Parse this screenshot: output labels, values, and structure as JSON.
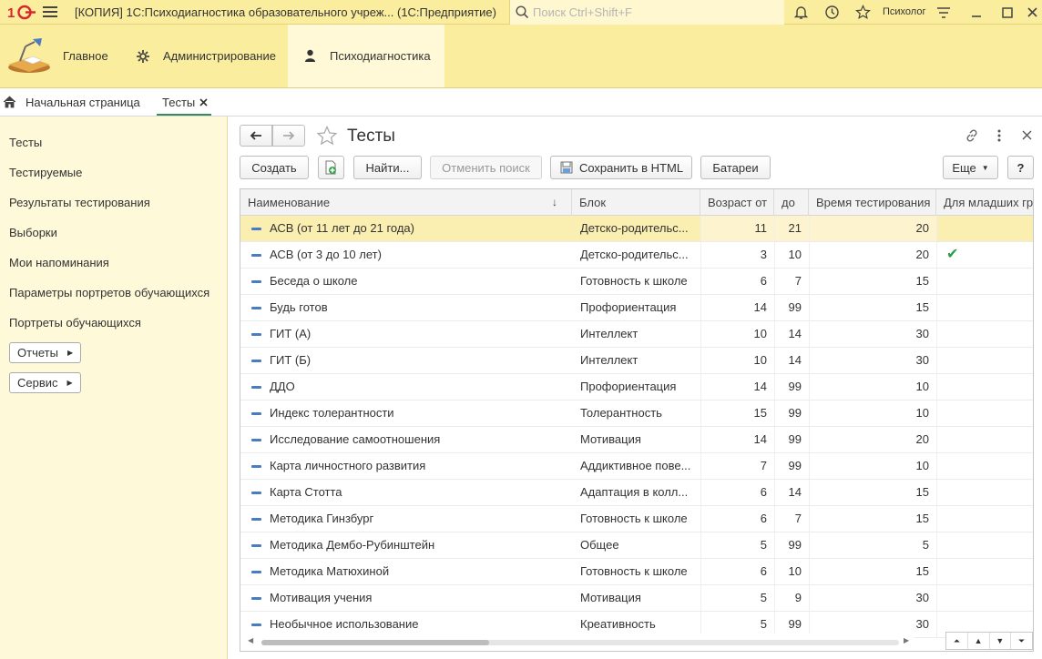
{
  "window": {
    "title": "[КОПИЯ] 1С:Психодиагностика образовательного учреж... (1С:Предприятие)",
    "search_placeholder": "Поиск Ctrl+Shift+F",
    "user": "Психолог"
  },
  "sections": [
    {
      "label": "Главное"
    },
    {
      "label": "Администрирование"
    },
    {
      "label": "Психодиагностика"
    }
  ],
  "tabs": {
    "home": "Начальная страница",
    "open": "Тесты"
  },
  "nav": {
    "links": [
      "Тесты",
      "Тестируемые",
      "Результаты тестирования",
      "Выборки",
      "Мои напоминания",
      "Параметры портретов обучающихся",
      "Портреты обучающихся"
    ],
    "groups": [
      "Отчеты",
      "Сервис"
    ]
  },
  "form": {
    "title": "Тесты",
    "buttons": {
      "create": "Создать",
      "find": "Найти...",
      "cancel_search": "Отменить поиск",
      "save_html": "Сохранить в HTML",
      "batteries": "Батареи",
      "more": "Еще",
      "help": "?"
    }
  },
  "table": {
    "columns": [
      "Наименование",
      "Блок",
      "Возраст от",
      "до",
      "Время тестирования",
      "Для младших гр"
    ],
    "rows": [
      {
        "name": "АСВ (от 11 лет до 21 года)",
        "block": "Детско-родительс...",
        "age_from": "11",
        "age_to": "21",
        "time": "20",
        "junior": ""
      },
      {
        "name": "АСВ (от 3 до 10 лет)",
        "block": "Детско-родительс...",
        "age_from": "3",
        "age_to": "10",
        "time": "20",
        "junior": "✔"
      },
      {
        "name": "Беседа о школе",
        "block": "Готовность к школе",
        "age_from": "6",
        "age_to": "7",
        "time": "15",
        "junior": ""
      },
      {
        "name": "Будь готов",
        "block": "Профориентация",
        "age_from": "14",
        "age_to": "99",
        "time": "15",
        "junior": ""
      },
      {
        "name": "ГИТ (А)",
        "block": "Интеллект",
        "age_from": "10",
        "age_to": "14",
        "time": "30",
        "junior": ""
      },
      {
        "name": "ГИТ (Б)",
        "block": "Интеллект",
        "age_from": "10",
        "age_to": "14",
        "time": "30",
        "junior": ""
      },
      {
        "name": "ДДО",
        "block": "Профориентация",
        "age_from": "14",
        "age_to": "99",
        "time": "10",
        "junior": ""
      },
      {
        "name": "Индекс толерантности",
        "block": "Толерантность",
        "age_from": "15",
        "age_to": "99",
        "time": "10",
        "junior": ""
      },
      {
        "name": "Исследование самоотношения",
        "block": "Мотивация",
        "age_from": "14",
        "age_to": "99",
        "time": "20",
        "junior": ""
      },
      {
        "name": "Карта личностного развития",
        "block": "Аддиктивное пове...",
        "age_from": "7",
        "age_to": "99",
        "time": "10",
        "junior": ""
      },
      {
        "name": "Карта Стотта",
        "block": "Адаптация в колл...",
        "age_from": "6",
        "age_to": "14",
        "time": "15",
        "junior": ""
      },
      {
        "name": "Методика Гинзбург",
        "block": "Готовность к школе",
        "age_from": "6",
        "age_to": "7",
        "time": "15",
        "junior": ""
      },
      {
        "name": "Методика Дембо-Рубинштейн",
        "block": "Общее",
        "age_from": "5",
        "age_to": "99",
        "time": "5",
        "junior": ""
      },
      {
        "name": "Методика Матюхиной",
        "block": "Готовность к школе",
        "age_from": "6",
        "age_to": "10",
        "time": "15",
        "junior": ""
      },
      {
        "name": "Мотивация учения",
        "block": "Мотивация",
        "age_from": "5",
        "age_to": "9",
        "time": "30",
        "junior": ""
      },
      {
        "name": "Необычное использование",
        "block": "Креативность",
        "age_from": "5",
        "age_to": "99",
        "time": "30",
        "junior": ""
      }
    ]
  },
  "colors": {
    "accent": "#fbed9e",
    "nav_bg": "#fef9d9",
    "selected_row": "#fbeeb1",
    "check": "#2e9a4a"
  }
}
